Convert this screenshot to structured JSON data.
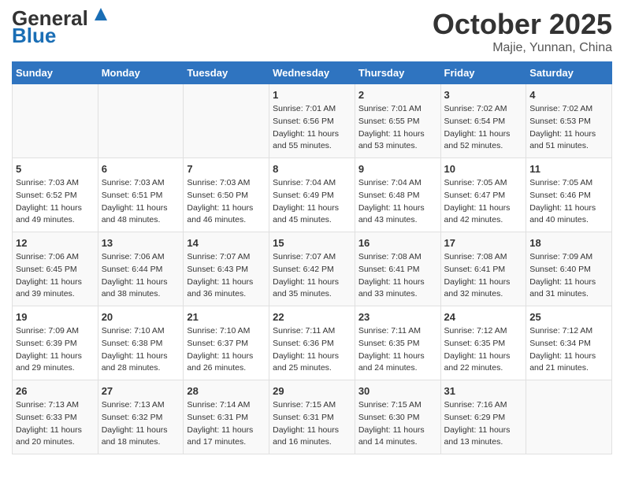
{
  "header": {
    "logo_general": "General",
    "logo_blue": "Blue",
    "month_title": "October 2025",
    "location": "Majie, Yunnan, China"
  },
  "days_of_week": [
    "Sunday",
    "Monday",
    "Tuesday",
    "Wednesday",
    "Thursday",
    "Friday",
    "Saturday"
  ],
  "weeks": [
    {
      "cells": [
        {
          "day": "",
          "info": ""
        },
        {
          "day": "",
          "info": ""
        },
        {
          "day": "",
          "info": ""
        },
        {
          "day": "1",
          "info": "Sunrise: 7:01 AM\nSunset: 6:56 PM\nDaylight: 11 hours\nand 55 minutes."
        },
        {
          "day": "2",
          "info": "Sunrise: 7:01 AM\nSunset: 6:55 PM\nDaylight: 11 hours\nand 53 minutes."
        },
        {
          "day": "3",
          "info": "Sunrise: 7:02 AM\nSunset: 6:54 PM\nDaylight: 11 hours\nand 52 minutes."
        },
        {
          "day": "4",
          "info": "Sunrise: 7:02 AM\nSunset: 6:53 PM\nDaylight: 11 hours\nand 51 minutes."
        }
      ]
    },
    {
      "cells": [
        {
          "day": "5",
          "info": "Sunrise: 7:03 AM\nSunset: 6:52 PM\nDaylight: 11 hours\nand 49 minutes."
        },
        {
          "day": "6",
          "info": "Sunrise: 7:03 AM\nSunset: 6:51 PM\nDaylight: 11 hours\nand 48 minutes."
        },
        {
          "day": "7",
          "info": "Sunrise: 7:03 AM\nSunset: 6:50 PM\nDaylight: 11 hours\nand 46 minutes."
        },
        {
          "day": "8",
          "info": "Sunrise: 7:04 AM\nSunset: 6:49 PM\nDaylight: 11 hours\nand 45 minutes."
        },
        {
          "day": "9",
          "info": "Sunrise: 7:04 AM\nSunset: 6:48 PM\nDaylight: 11 hours\nand 43 minutes."
        },
        {
          "day": "10",
          "info": "Sunrise: 7:05 AM\nSunset: 6:47 PM\nDaylight: 11 hours\nand 42 minutes."
        },
        {
          "day": "11",
          "info": "Sunrise: 7:05 AM\nSunset: 6:46 PM\nDaylight: 11 hours\nand 40 minutes."
        }
      ]
    },
    {
      "cells": [
        {
          "day": "12",
          "info": "Sunrise: 7:06 AM\nSunset: 6:45 PM\nDaylight: 11 hours\nand 39 minutes."
        },
        {
          "day": "13",
          "info": "Sunrise: 7:06 AM\nSunset: 6:44 PM\nDaylight: 11 hours\nand 38 minutes."
        },
        {
          "day": "14",
          "info": "Sunrise: 7:07 AM\nSunset: 6:43 PM\nDaylight: 11 hours\nand 36 minutes."
        },
        {
          "day": "15",
          "info": "Sunrise: 7:07 AM\nSunset: 6:42 PM\nDaylight: 11 hours\nand 35 minutes."
        },
        {
          "day": "16",
          "info": "Sunrise: 7:08 AM\nSunset: 6:41 PM\nDaylight: 11 hours\nand 33 minutes."
        },
        {
          "day": "17",
          "info": "Sunrise: 7:08 AM\nSunset: 6:41 PM\nDaylight: 11 hours\nand 32 minutes."
        },
        {
          "day": "18",
          "info": "Sunrise: 7:09 AM\nSunset: 6:40 PM\nDaylight: 11 hours\nand 31 minutes."
        }
      ]
    },
    {
      "cells": [
        {
          "day": "19",
          "info": "Sunrise: 7:09 AM\nSunset: 6:39 PM\nDaylight: 11 hours\nand 29 minutes."
        },
        {
          "day": "20",
          "info": "Sunrise: 7:10 AM\nSunset: 6:38 PM\nDaylight: 11 hours\nand 28 minutes."
        },
        {
          "day": "21",
          "info": "Sunrise: 7:10 AM\nSunset: 6:37 PM\nDaylight: 11 hours\nand 26 minutes."
        },
        {
          "day": "22",
          "info": "Sunrise: 7:11 AM\nSunset: 6:36 PM\nDaylight: 11 hours\nand 25 minutes."
        },
        {
          "day": "23",
          "info": "Sunrise: 7:11 AM\nSunset: 6:35 PM\nDaylight: 11 hours\nand 24 minutes."
        },
        {
          "day": "24",
          "info": "Sunrise: 7:12 AM\nSunset: 6:35 PM\nDaylight: 11 hours\nand 22 minutes."
        },
        {
          "day": "25",
          "info": "Sunrise: 7:12 AM\nSunset: 6:34 PM\nDaylight: 11 hours\nand 21 minutes."
        }
      ]
    },
    {
      "cells": [
        {
          "day": "26",
          "info": "Sunrise: 7:13 AM\nSunset: 6:33 PM\nDaylight: 11 hours\nand 20 minutes."
        },
        {
          "day": "27",
          "info": "Sunrise: 7:13 AM\nSunset: 6:32 PM\nDaylight: 11 hours\nand 18 minutes."
        },
        {
          "day": "28",
          "info": "Sunrise: 7:14 AM\nSunset: 6:31 PM\nDaylight: 11 hours\nand 17 minutes."
        },
        {
          "day": "29",
          "info": "Sunrise: 7:15 AM\nSunset: 6:31 PM\nDaylight: 11 hours\nand 16 minutes."
        },
        {
          "day": "30",
          "info": "Sunrise: 7:15 AM\nSunset: 6:30 PM\nDaylight: 11 hours\nand 14 minutes."
        },
        {
          "day": "31",
          "info": "Sunrise: 7:16 AM\nSunset: 6:29 PM\nDaylight: 11 hours\nand 13 minutes."
        },
        {
          "day": "",
          "info": ""
        }
      ]
    }
  ]
}
